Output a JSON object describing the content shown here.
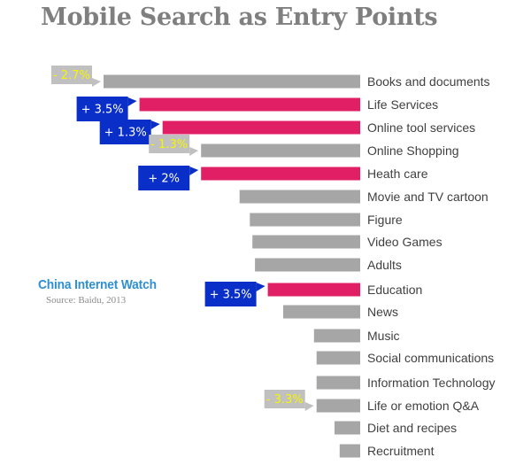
{
  "chart_data": {
    "type": "bar",
    "orientation": "horizontal",
    "title": "Mobile Search as Entry Points",
    "brand": "China Internet Watch",
    "source": "Source: Baidu, 2013",
    "value_unit": "relative share (% of largest bar, no axis shown)",
    "grid": false,
    "legend": "none",
    "colors": {
      "highlight": "#e01f65",
      "normal": "#a6a6a6",
      "callout_up": "#0a2fc8",
      "callout_down": "#c0c0c0",
      "callout_up_text": "#ffffff",
      "callout_down_text": "#f5f500"
    },
    "categories": [
      "Books and documents",
      "Life Services",
      "Online tool services",
      "Online Shopping",
      "Heath care",
      "Movie and TV cartoon",
      "Figure",
      "Video Games",
      "Adults",
      "Education",
      "News",
      "Music",
      "Social communications",
      "Information Technology",
      "Life or emotion Q&A",
      "Diet and recipes",
      "Recruitment"
    ],
    "values": [
      100,
      86,
      77,
      62,
      62,
      47,
      43,
      42,
      41,
      36,
      30,
      18,
      17,
      17,
      17,
      10,
      8
    ],
    "highlighted": [
      false,
      true,
      true,
      false,
      true,
      false,
      false,
      false,
      false,
      true,
      false,
      false,
      false,
      false,
      false,
      false,
      false
    ],
    "changes": [
      {
        "category": "Books and documents",
        "label": "- 2.7%",
        "direction": "down"
      },
      {
        "category": "Life Services",
        "label": "+ 3.5%",
        "direction": "up"
      },
      {
        "category": "Online tool services",
        "label": "+ 1.3%",
        "direction": "up"
      },
      {
        "category": "Online Shopping",
        "label": "- 1.3%",
        "direction": "down"
      },
      {
        "category": "Heath care",
        "label": "+ 2%",
        "direction": "up"
      },
      {
        "category": "Education",
        "label": "+ 3.5%",
        "direction": "up"
      },
      {
        "category": "Life or emotion Q&A",
        "label": "- 3.3%",
        "direction": "down"
      }
    ]
  }
}
